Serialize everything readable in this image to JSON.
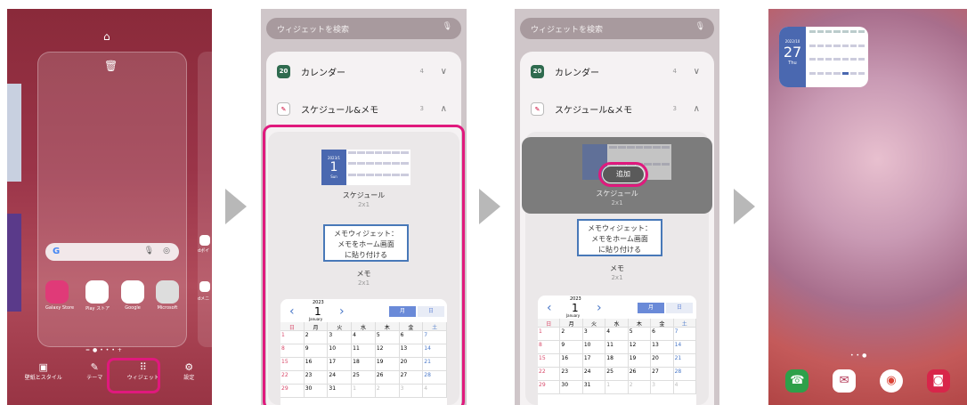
{
  "screen1": {
    "edit_bar": [
      "壁紙とスタイル",
      "テーマ",
      "ウィジェット",
      "設定"
    ],
    "apps": [
      "Galaxy Store",
      "Play ストア",
      "Google",
      "Microsoft"
    ],
    "right_partial_labels": [
      "dポイ",
      "dメニ"
    ]
  },
  "screen2": {
    "search_placeholder": "ウィジェットを検索",
    "calendar": {
      "label": "カレンダー",
      "count": "4",
      "icon_text": "20"
    },
    "schedule": {
      "label": "スケジュール&メモ",
      "count": "3"
    },
    "widget1": {
      "name": "スケジュール",
      "size": "2x1",
      "date_header": "2023/1",
      "day": "1",
      "dow": "Sun"
    },
    "widget2": {
      "lines": [
        "メモウィジェット：",
        "メモをホーム画面",
        "に貼り付ける"
      ],
      "name": "メモ",
      "size": "2x1"
    },
    "widget3": {
      "year": "2023",
      "day": "1",
      "month": "January",
      "tab_month": "月",
      "tab_day": "日",
      "weekdays": [
        "日",
        "月",
        "火",
        "水",
        "木",
        "金",
        "土"
      ],
      "dates": [
        "1",
        "2",
        "3",
        "4",
        "5",
        "6",
        "7",
        "8",
        "9",
        "10",
        "11",
        "12",
        "13",
        "14",
        "15",
        "16",
        "17",
        "18",
        "19",
        "20",
        "21",
        "22",
        "23",
        "24",
        "25",
        "26",
        "27",
        "28",
        "29",
        "30",
        "31",
        "1",
        "2",
        "3",
        "4"
      ]
    }
  },
  "screen3": {
    "search_placeholder": "ウィジェットを検索",
    "add_button": "追加"
  },
  "screen4": {
    "calendar": {
      "date_header": "2022/10",
      "day": "27",
      "dow": "Thu"
    }
  }
}
